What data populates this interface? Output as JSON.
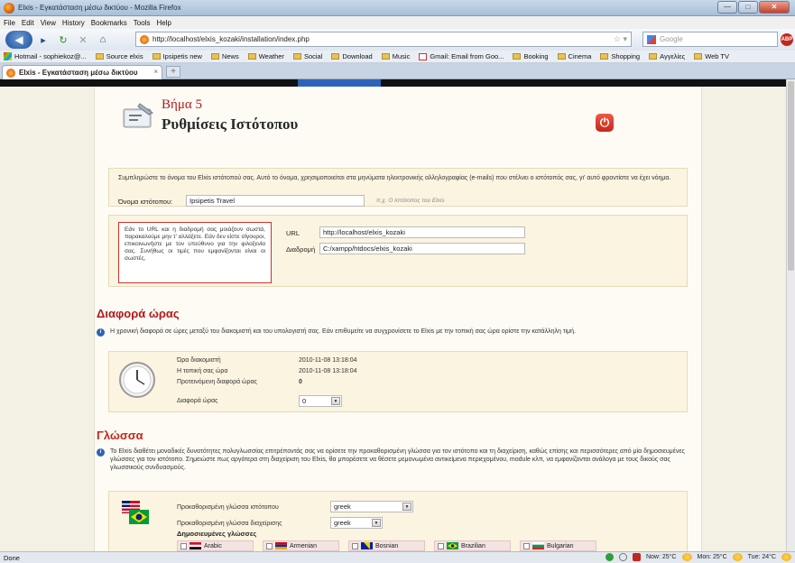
{
  "window": {
    "title": "Elxis - Εγκατάσταση μέσω δικτύου - Mozilla Firefox",
    "buttons": [
      "—",
      "□",
      "✕"
    ]
  },
  "menu": [
    "File",
    "Edit",
    "View",
    "History",
    "Bookmarks",
    "Tools",
    "Help"
  ],
  "navigation": {
    "url": "http://localhost/elxis_kozaki/installation/index.php",
    "search_placeholder": "Google"
  },
  "bookmarks": [
    {
      "label": "Hotmail - sophiekoz@...",
      "icon": "hotmail-icon"
    },
    {
      "label": "Source elxis",
      "icon": "folder-icon"
    },
    {
      "label": "Ipsipetis new",
      "icon": "folder-icon"
    },
    {
      "label": "News",
      "icon": "folder-icon"
    },
    {
      "label": "Weather",
      "icon": "folder-icon"
    },
    {
      "label": "Social",
      "icon": "folder-icon"
    },
    {
      "label": "Download",
      "icon": "folder-icon"
    },
    {
      "label": "Music",
      "icon": "folder-icon"
    },
    {
      "label": "Gmail: Email from Goo...",
      "icon": "gmail-icon"
    },
    {
      "label": "Booking",
      "icon": "folder-icon"
    },
    {
      "label": "Cinema",
      "icon": "folder-icon"
    },
    {
      "label": "Shopping",
      "icon": "folder-icon"
    },
    {
      "label": "Αγγελίες",
      "icon": "folder-icon"
    },
    {
      "label": "Web TV",
      "icon": "folder-icon"
    }
  ],
  "tab": {
    "title": "Elxis - Εγκατάσταση μέσω δικτύου",
    "close": "×",
    "new_tab": "+"
  },
  "page": {
    "step_title": "Βήμα 5",
    "step_subtitle": "Ρυθμίσεις Ιστότοπου",
    "site_intro": "Συμπληρώστε το όνομα του Elxis ιστότοπού σας. Αυτό το όνομα, χρησιμοποιείται στα μηνύματα ηλεκτρονικής αλληλογραφίας (e-mails) που στέλνει ο ιστότοπός σας, γι' αυτό φροντίστε να έχει νόημα.",
    "site_name_label": "Όνομα ιστότοπου:",
    "site_name_value": "Ipsipetis Travel",
    "site_name_hint": "π.χ. Ο Ιστότοπος του Elxis",
    "url_note": "Εάν το URL και η διαδρομή σας μοιάζουν σωστά, παρακαλούμε μην τ' αλλάξετε. Εάν δεν είστε σίγουροι, επικοινωνήστε με τον υπεύθυνο για την φιλοξενία σας. Συνήθως οι τιμές που εμφανίζονται είναι οι σωστές.",
    "url_label": "URL",
    "url_value": "http://localhost/elxis_kozaki",
    "path_label": "Διαδρομή",
    "path_value": "C:/xampp/htdocs/elxis_kozaki",
    "time_title": "Διαφορά ώρας",
    "time_info": "Η χρονική διαφορά σε ώρες μεταξύ του διακομιστή και του υπολογιστή σας. Εάν επιθυμείτε να συγχρονίσετε το Elxis με την τοπική σας ώρα ορίστε την κατάλληλη τιμή.",
    "server_time_label": "Ώρα διακομιστή",
    "server_time_value": "2010-11-08 13:18:04",
    "local_time_label": "Η τοπική σας ώρα",
    "local_time_value": "2010-11-08 13:18:04",
    "suggested_offset_label": "Προτεινόμενη διαφορά ώρας",
    "suggested_offset_value": "0",
    "offset_label": "Διαφορά ώρας",
    "offset_value": "0",
    "lang_title": "Γλώσσα",
    "lang_info": "Το Elxis διαθέτει μοναδικές δυνατότητες πολυγλωσσίας επιτρέποντάς σας να ορίσετε την προκαθορισμένη γλώσσα για τον ιστότοπο και τη διαχείριση, καθώς επίσης και περισσότερες από μία δημοσιευμένες γλώσσες για τον ιστότοπο. Σημειώστε πως αργότερα στη διαχείριση του Elxis, θα μπορέσετε να θέσετε μεμονωμένα αντικείμενα περιεχομένου, module κλπ, να εμφανίζονται ανάλογα με τους δικούς σας γλωσσικούς συνδυασμούς.",
    "default_site_lang_label": "Προκαθορισμένη γλώσσα ιστότοπου",
    "default_site_lang_value": "greek",
    "default_admin_lang_label": "Προκαθορισμένη γλώσσα διαχείρισης",
    "default_admin_lang_value": "greek",
    "published_title": "Δημοσιευμένες γλώσσες",
    "languages": [
      "Arabic",
      "Armenian",
      "Bosnian",
      "Brazilian",
      "Bulgarian"
    ]
  },
  "status": {
    "text": "Done",
    "weather_now": "Now: 25°C",
    "weather_mon": "Mon: 25°C",
    "weather_tue": "Tue: 24°C"
  }
}
